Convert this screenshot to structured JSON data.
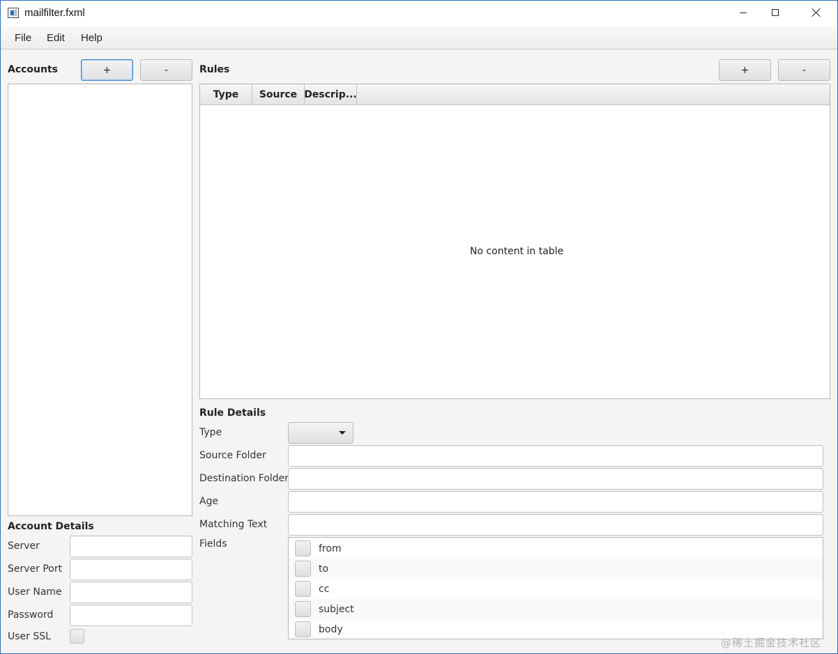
{
  "window": {
    "title": "mailfilter.fxml"
  },
  "menu": [
    "File",
    "Edit",
    "Help"
  ],
  "accounts": {
    "title": "Accounts",
    "add_label": "+",
    "remove_label": "-"
  },
  "account_details": {
    "title": "Account Details",
    "fields": [
      {
        "label": "Server",
        "value": ""
      },
      {
        "label": "Server Port",
        "value": ""
      },
      {
        "label": "User Name",
        "value": ""
      },
      {
        "label": "Password",
        "value": ""
      }
    ],
    "ssl_label": "User SSL"
  },
  "rules": {
    "title": "Rules",
    "add_label": "+",
    "remove_label": "-",
    "columns": [
      "Type",
      "Source",
      "Descrip..."
    ],
    "empty_text": "No content in table"
  },
  "rule_details": {
    "title": "Rule Details",
    "type_label": "Type",
    "type_value": "",
    "source_folder_label": "Source Folder",
    "destination_folder_label": "Destination Folder",
    "age_label": "Age",
    "matching_text_label": "Matching Text",
    "fields_label": "Fields",
    "field_options": [
      "from",
      "to",
      "cc",
      "subject",
      "body"
    ]
  },
  "watermark": "@稀土掘金技术社区"
}
